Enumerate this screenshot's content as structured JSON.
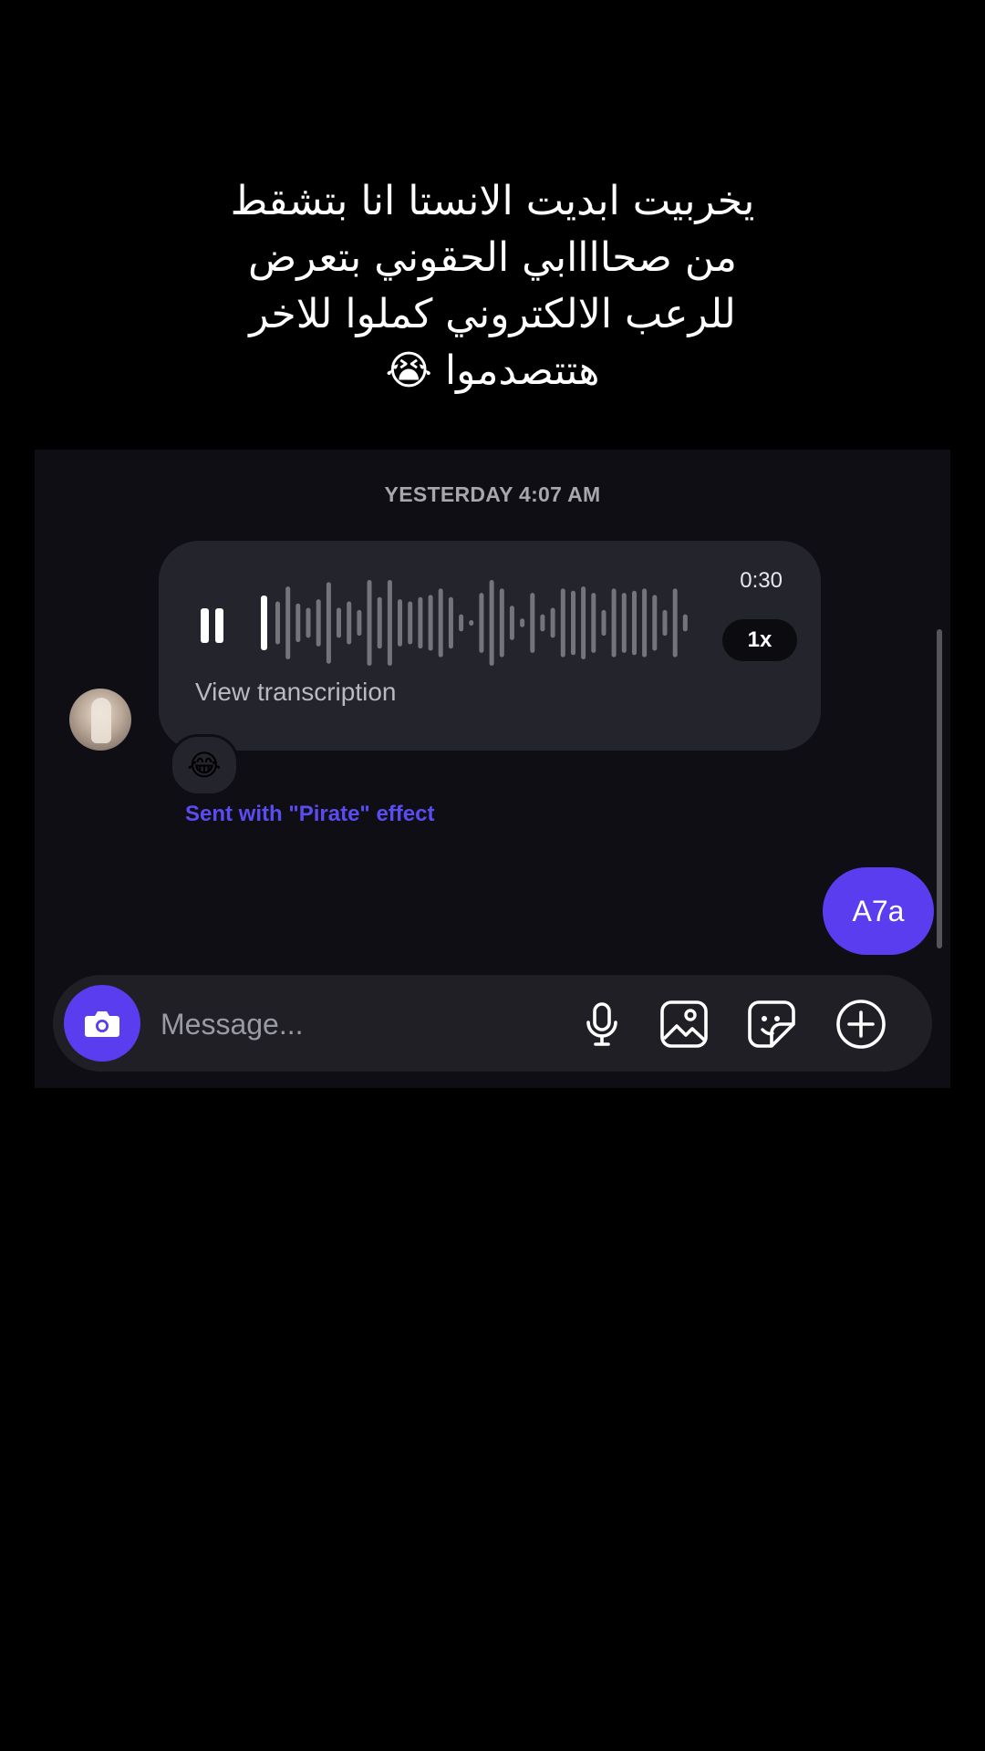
{
  "caption": {
    "lines": [
      "يخربيت ابديت الانستا انا بتشقط",
      "من صحاااابي الحقوني بتعرض",
      "للرعب الالكتروني  كملوا للاخر",
      "هتتصدموا 😭"
    ]
  },
  "chat": {
    "timestamp": "YESTERDAY 4:07 AM",
    "voice_message": {
      "duration": "0:30",
      "speed": "1x",
      "transcription_link": "View transcription",
      "waveform_levels": [
        0.5,
        0.85,
        0.45,
        0.35,
        0.55,
        0.95,
        0.35,
        0.5,
        0.3,
        1.0,
        0.6,
        1.0,
        0.55,
        0.5,
        0.6,
        0.65,
        0.8,
        0.6,
        0.2,
        0.05,
        0.7,
        1.0,
        0.8,
        0.4,
        0.1,
        0.7,
        0.2,
        0.35,
        0.8,
        0.75,
        0.85,
        0.7,
        0.3,
        0.8,
        0.7,
        0.75,
        0.8,
        0.65,
        0.3,
        0.8,
        0.2
      ],
      "played_fraction": 0.0
    },
    "reaction_emoji": "😂",
    "effect_note": "Sent with \"Pirate\" effect",
    "sent_message": "A7a"
  },
  "composer": {
    "placeholder": "Message..."
  },
  "icons": {
    "camera": "camera-icon",
    "mic": "microphone-icon",
    "gallery": "image-icon",
    "sticker": "sticker-icon",
    "add": "plus-circle-icon",
    "pause": "pause-icon"
  },
  "colors": {
    "accent": "#5a3dee",
    "effect_text": "#5b4cf2",
    "bubble": "#24242c",
    "chat_background": "#0e0e14"
  }
}
